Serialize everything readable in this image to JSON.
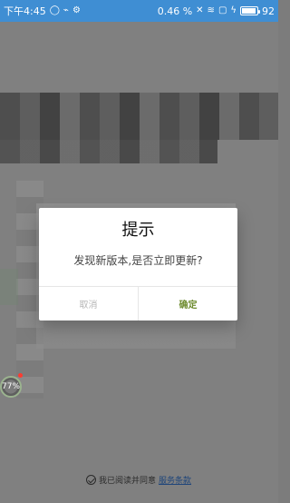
{
  "status_bar": {
    "time": "下午4:45",
    "speed": "0.46 %",
    "battery": "92",
    "battery_level_percent": 92,
    "icons": [
      "chat-bubble-icon",
      "usb-icon",
      "debug-icon",
      "bluetooth-off-icon",
      "wifi-icon",
      "nfc-icon",
      "charging-icon"
    ]
  },
  "background": {
    "floating_progress_text": "77%"
  },
  "dialog": {
    "title": "提示",
    "message": "发现新版本,是否立即更新?",
    "cancel_label": "取消",
    "confirm_label": "确定"
  },
  "agreement": {
    "text": "我已阅读并同意",
    "link": "服务条款"
  },
  "colors": {
    "status_bar": "#3f8ed3",
    "confirm": "#6e8c2f",
    "cancel": "#b6b6b6",
    "overlay": "#7c7c7c"
  }
}
